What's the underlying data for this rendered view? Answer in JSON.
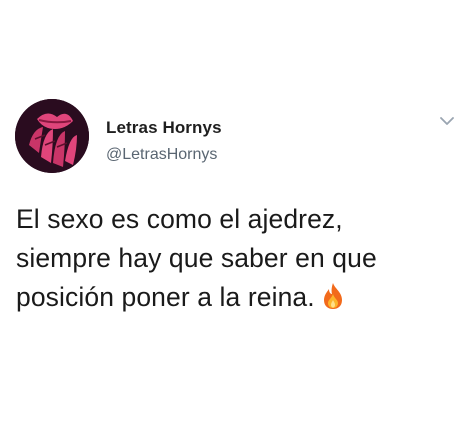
{
  "tweet": {
    "author": {
      "display_name": "Letras Hornys",
      "handle": "@LetrasHornys"
    },
    "text_lines": [
      "El sexo es como el ajedrez,",
      "siempre hay que saber en que",
      "posición poner a la reina."
    ],
    "emoji": "fire-icon",
    "menu_icon": "chevron-down-icon"
  },
  "colors": {
    "background": "#ffffff",
    "name_text": "#1f1f1f",
    "handle_text": "#5a6672",
    "body_text": "#1a1a1a",
    "chevron": "#9aa5b1",
    "avatar_bg": "#2a0c1f",
    "avatar_accent": "#e0457b"
  }
}
